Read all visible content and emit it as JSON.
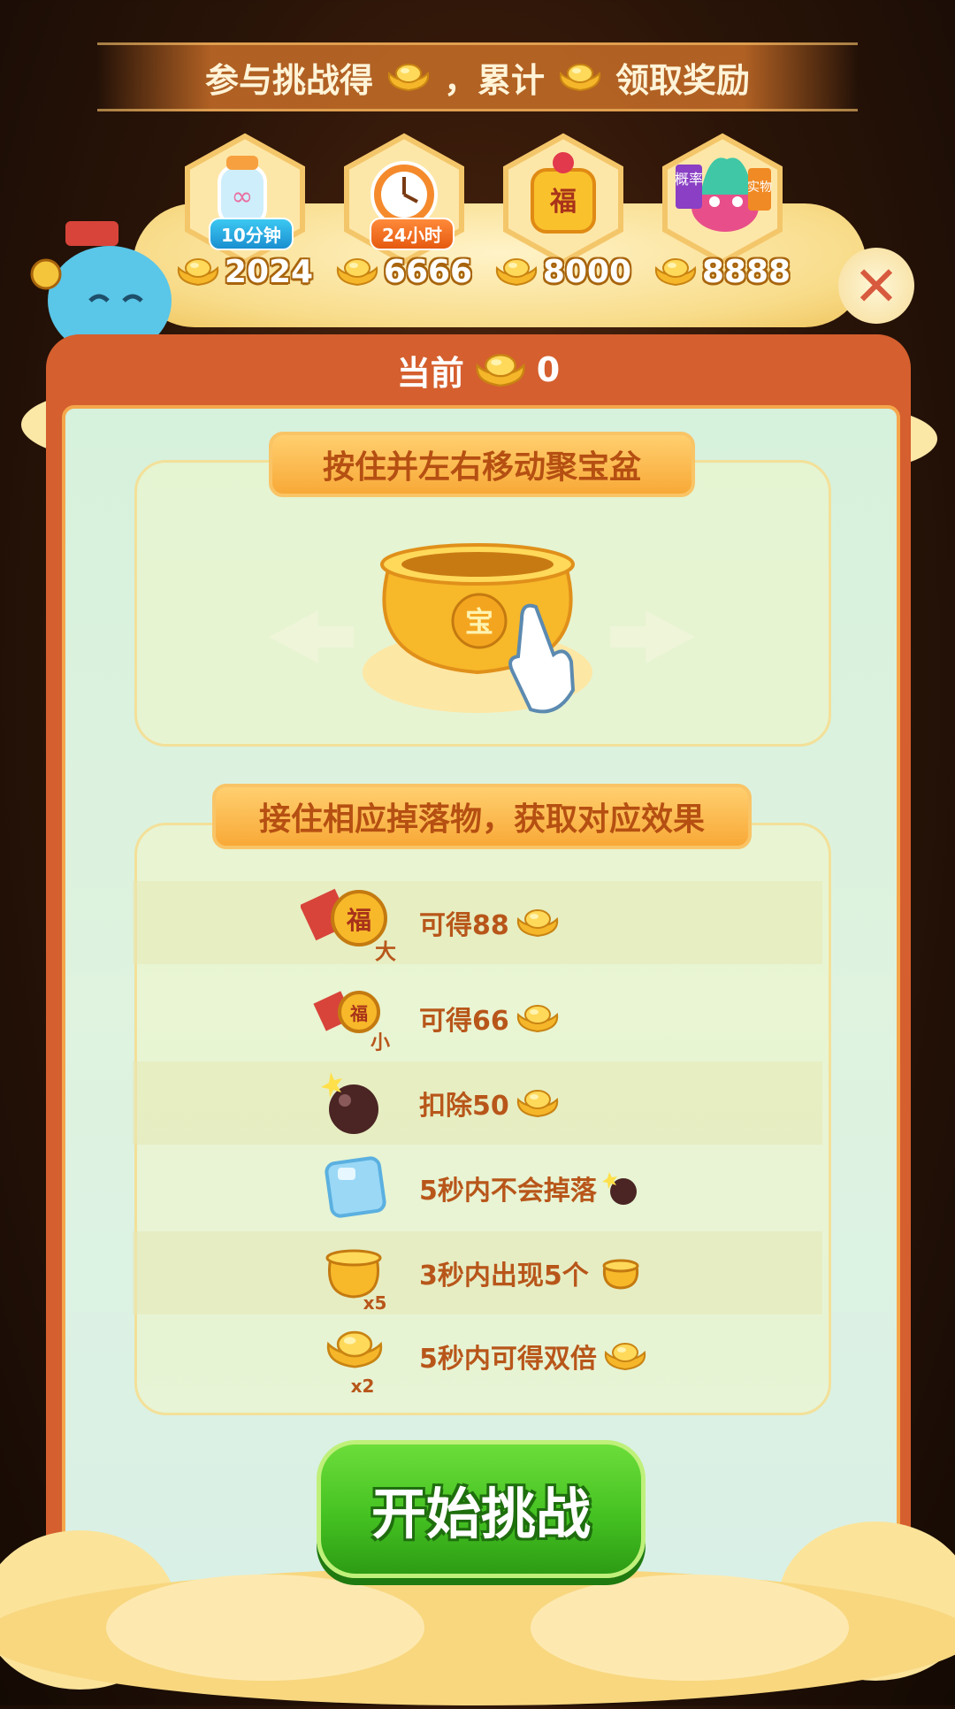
{
  "banner": {
    "prefix": "参与挑战得",
    "middle": "，累计",
    "suffix": "领取奖励"
  },
  "rewards": [
    {
      "tag": "10分钟",
      "amount": "2024",
      "icon": "bottle-icon"
    },
    {
      "tag": "24小时",
      "amount": "6666",
      "icon": "clock-icon"
    },
    {
      "tag": "",
      "amount": "8000",
      "icon": "fu-bag-icon"
    },
    {
      "tag": "",
      "amount": "8888",
      "icon": "bird-prize-icon",
      "badge_left": "概率",
      "badge_right": "实物"
    }
  ],
  "fu_char": "福",
  "bao_char": "宝",
  "current": {
    "label": "当前",
    "value": "0"
  },
  "instruction1": "按住并左右移动聚宝盆",
  "instruction2": "接住相应掉落物，获取对应效果",
  "effects": [
    {
      "text": "可得88",
      "icon": "big-fu-coin-icon",
      "badge": "大"
    },
    {
      "text": "可得66",
      "icon": "small-fu-coin-icon",
      "badge": "小"
    },
    {
      "text": "扣除50",
      "icon": "bomb-icon"
    },
    {
      "text": "5秒内不会掉落",
      "icon": "ice-cube-icon"
    },
    {
      "text": "3秒内出现5个",
      "icon": "pot-icon",
      "badge": "x5"
    },
    {
      "text": "5秒内可得双倍",
      "icon": "ingot-icon",
      "badge": "x2"
    }
  ],
  "start_button": "开始挑战",
  "close_symbol": "✕",
  "colors": {
    "panel": "#d55f2e",
    "accent": "#f8a937",
    "text": "#b8561a",
    "start": "#45c222"
  }
}
